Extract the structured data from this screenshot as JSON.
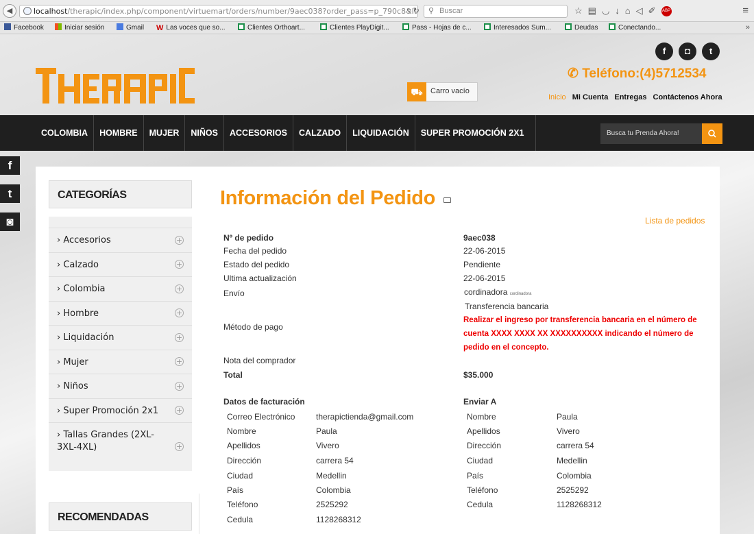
{
  "browser": {
    "url_host": "localhost",
    "url_path": "/therapic/index.php/component/virtuemart/orders/number/9aec038?order_pass=p_790c8&Itemi",
    "search_placeholder": "Buscar",
    "bookmarks": [
      "Facebook",
      "Iniciar sesión",
      "Gmail",
      "Las voces que so...",
      "Clientes Orthoart...",
      "Clientes PlayDigit...",
      "Pass - Hojas de c...",
      "Interesados Sum...",
      "Deudas",
      "Conectando..."
    ],
    "abp_label": "ABP"
  },
  "site": {
    "logo_text": "THERAPIC",
    "phone": "Teléfono:(4)5712534",
    "top_links": [
      "Inicio",
      "Mi Cuenta",
      "Entregas",
      "Contáctenos Ahora"
    ],
    "cart_label": "Carro vacío",
    "nav": [
      "COLOMBIA",
      "HOMBRE",
      "MUJER",
      "NIÑOS",
      "ACCESORIOS",
      "CALZADO",
      "LIQUIDACIÓN",
      "SUPER PROMOCIÓN 2X1"
    ],
    "search_placeholder": "Busca tu Prenda Ahora!",
    "social_top": [
      "f",
      "◘",
      "t"
    ],
    "social_side": [
      "f",
      "t",
      "◙"
    ]
  },
  "sidebar": {
    "categories_title": "CATEGORÍAS",
    "categories": [
      "Accesorios",
      "Calzado",
      "Colombia",
      "Hombre",
      "Liquidación",
      "Mujer",
      "Niños",
      "Super Promoción 2x1",
      "Tallas Grandes (2XL-3XL-4XL)"
    ],
    "recommended_title": "RECOMENDADAS"
  },
  "order": {
    "title": "Información del Pedido",
    "list_link": "Lista de pedidos",
    "rows": [
      {
        "label": "Nº de pedido",
        "value": "9aec038"
      },
      {
        "label": "Fecha del pedido",
        "value": "22-06-2015"
      },
      {
        "label": "Estado del pedido",
        "value": "Pendiente"
      },
      {
        "label": "Ultima actualización",
        "value": "22-06-2015"
      },
      {
        "label": "Envío",
        "value": "cordinadora",
        "value_small": "cordinadora"
      },
      {
        "label": "Método de pago",
        "value": "Transferencia bancaria",
        "note": "Realizar el ingreso por transferencia bancaria en el número de cuenta XXXX XXXX XX XXXXXXXXXX indicando el número de pedido en el concepto."
      },
      {
        "label": "Nota del comprador",
        "value": ""
      },
      {
        "label": "Total",
        "value": "$35.000"
      }
    ],
    "billing": {
      "title": "Datos de facturación",
      "fields": [
        {
          "label": "Correo Electrónico",
          "value": "therapictienda@gmail.com"
        },
        {
          "label": "Nombre",
          "value": "Paula"
        },
        {
          "label": "Apellidos",
          "value": "Vivero"
        },
        {
          "label": "Dirección",
          "value": "carrera 54"
        },
        {
          "label": "Ciudad",
          "value": "Medellin"
        },
        {
          "label": "País",
          "value": "Colombia"
        },
        {
          "label": "Teléfono",
          "value": "2525292"
        },
        {
          "label": "Cedula",
          "value": "1128268312"
        }
      ]
    },
    "shipping": {
      "title": "Enviar A",
      "fields": [
        {
          "label": "Nombre",
          "value": "Paula"
        },
        {
          "label": "Apellidos",
          "value": "Vivero"
        },
        {
          "label": "Dirección",
          "value": "carrera 54"
        },
        {
          "label": "Ciudad",
          "value": "Medellin"
        },
        {
          "label": "País",
          "value": "Colombia"
        },
        {
          "label": "Teléfono",
          "value": "2525292"
        },
        {
          "label": "Cedula",
          "value": "1128268312"
        }
      ]
    }
  },
  "colors": {
    "accent": "#f39412",
    "nav_bg": "#1f1f1f",
    "alert": "#ee0000"
  }
}
